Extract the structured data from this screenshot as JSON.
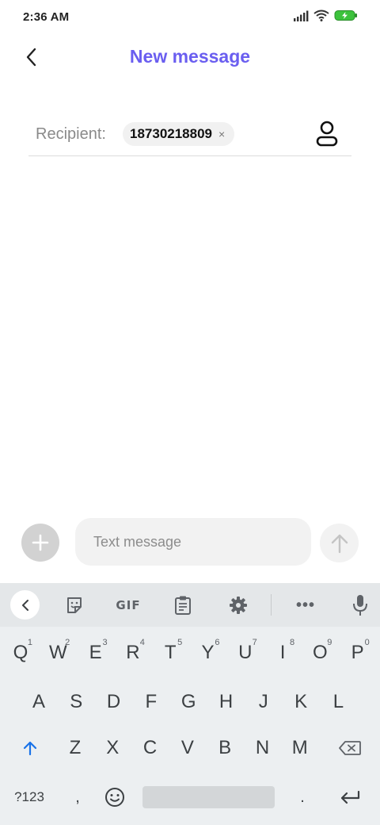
{
  "status_bar": {
    "time": "2:36 AM",
    "icons": [
      "signal-icon",
      "wifi-icon",
      "battery-charging-icon"
    ]
  },
  "header": {
    "title": "New message",
    "title_color": "#6a5ef0"
  },
  "recipient": {
    "label": "Recipient:",
    "chip_value": "18730218809",
    "chip_remove": "×"
  },
  "compose": {
    "placeholder": "Text message"
  },
  "keyboard": {
    "toolbar": {
      "gif_label": "GIF",
      "more_label": "•••"
    },
    "rows": [
      [
        {
          "label": "Q",
          "hint": "1"
        },
        {
          "label": "W",
          "hint": "2"
        },
        {
          "label": "E",
          "hint": "3"
        },
        {
          "label": "R",
          "hint": "4"
        },
        {
          "label": "T",
          "hint": "5"
        },
        {
          "label": "Y",
          "hint": "6"
        },
        {
          "label": "U",
          "hint": "7"
        },
        {
          "label": "I",
          "hint": "8"
        },
        {
          "label": "O",
          "hint": "9"
        },
        {
          "label": "P",
          "hint": "0"
        }
      ],
      [
        {
          "label": "A"
        },
        {
          "label": "S"
        },
        {
          "label": "D"
        },
        {
          "label": "F"
        },
        {
          "label": "G"
        },
        {
          "label": "H"
        },
        {
          "label": "J"
        },
        {
          "label": "K"
        },
        {
          "label": "L"
        }
      ],
      [
        {
          "label": "Z"
        },
        {
          "label": "X"
        },
        {
          "label": "C"
        },
        {
          "label": "V"
        },
        {
          "label": "B"
        },
        {
          "label": "N"
        },
        {
          "label": "M"
        }
      ]
    ],
    "bottom": {
      "symbols_label": "?123",
      "comma_label": ",",
      "period_label": "."
    },
    "shift_color": "#1a73e8"
  }
}
